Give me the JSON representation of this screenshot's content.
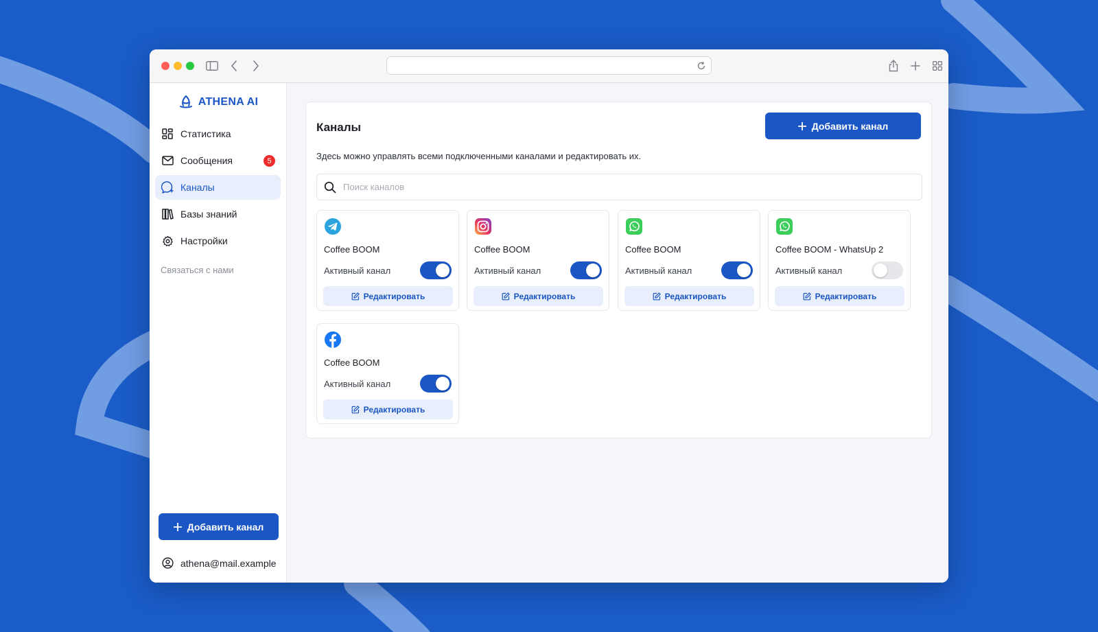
{
  "app": {
    "name": "ATHENA AI"
  },
  "sidebar": {
    "items": [
      {
        "label": "Статистика",
        "icon": "dashboard-icon",
        "active": false
      },
      {
        "label": "Сообщения",
        "icon": "mail-icon",
        "active": false,
        "badge": "5"
      },
      {
        "label": "Каналы",
        "icon": "chat-bubble-icon",
        "active": true
      },
      {
        "label": "Базы знаний",
        "icon": "library-icon",
        "active": false
      },
      {
        "label": "Настройки",
        "icon": "gear-icon",
        "active": false
      }
    ],
    "contact_label": "Связаться с нами",
    "add_button_label": "Добавить канал",
    "user_email": "athena@mail.example"
  },
  "main": {
    "title": "Каналы",
    "add_button_label": "Добавить канал",
    "description": "Здесь можно управлять всеми подключенными каналами и редактировать их.",
    "search": {
      "placeholder": "Поиск каналов",
      "value": ""
    },
    "channels": [
      {
        "platform_icon": "telegram-icon",
        "name": "Coffee BOOM",
        "active_label": "Активный канал",
        "active": true,
        "edit_label": "Редактировать"
      },
      {
        "platform_icon": "instagram-icon",
        "name": "Coffee BOOM",
        "active_label": "Активный канал",
        "active": true,
        "edit_label": "Редактировать"
      },
      {
        "platform_icon": "whatsapp-icon",
        "name": "Coffee BOOM",
        "active_label": "Активный канал",
        "active": true,
        "edit_label": "Редактировать"
      },
      {
        "platform_icon": "whatsapp-icon",
        "name": "Coffee BOOM - WhatsUp 2",
        "active_label": "Активный канал",
        "active": false,
        "edit_label": "Редактировать"
      },
      {
        "platform_icon": "facebook-icon",
        "name": "Coffee BOOM",
        "active_label": "Активный канал",
        "active": true,
        "edit_label": "Редактировать"
      }
    ]
  },
  "colors": {
    "accent": "#1a56c4",
    "background": "#1a5cc8",
    "badge": "#ef2b2b",
    "toggle_on": "#1a56c4",
    "toggle_off": "#e6e7ea"
  }
}
